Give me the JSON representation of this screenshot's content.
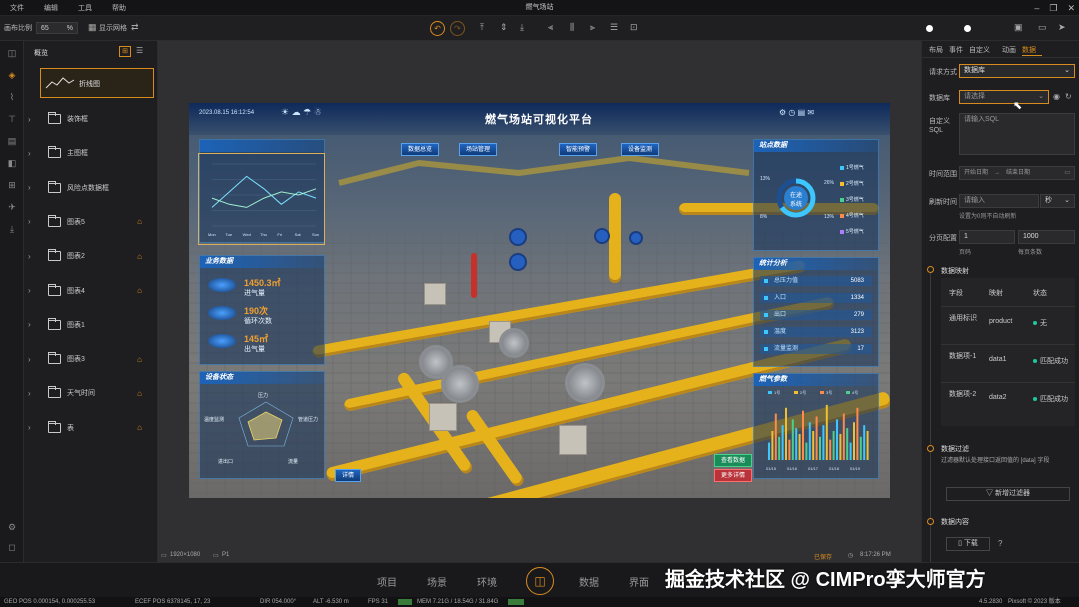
{
  "menubar": {
    "items": [
      "文件",
      "编辑",
      "工具",
      "帮助"
    ],
    "title": "燃气场站"
  },
  "toolbar": {
    "scale_label": "画布比例",
    "scale_value": "65",
    "scale_unit": "%",
    "grid_label": "显示网格",
    "right_btns": [
      "预览",
      "发布"
    ]
  },
  "layers": {
    "title": "概览",
    "top_item": "折线图",
    "items": [
      {
        "name": "装饰框",
        "locked": false
      },
      {
        "name": "主图框",
        "locked": false
      },
      {
        "name": "风险点数据框",
        "locked": false
      },
      {
        "name": "图表5",
        "locked": true
      },
      {
        "name": "图表2",
        "locked": true
      },
      {
        "name": "图表4",
        "locked": true
      },
      {
        "name": "图表1",
        "locked": false
      },
      {
        "name": "图表3",
        "locked": true
      },
      {
        "name": "天气时间",
        "locked": true
      },
      {
        "name": "表",
        "locked": true
      }
    ]
  },
  "scene": {
    "datetime": "2023.08.15 16:12:54",
    "title": "燃气场站可视化平台",
    "nav": [
      "数据总览",
      "场站管理",
      "智能预警",
      "设备监测"
    ],
    "panels": {
      "site": "站点数据",
      "business": "业务数据",
      "stats": "统计分析",
      "device": "设备状态",
      "gas": "燃气参数"
    },
    "ring_label": "在途\n系统",
    "pct_left": [
      "13%",
      "8%"
    ],
    "pct_right": [
      "26%",
      "13%"
    ],
    "legend": [
      "1号燃气",
      "2号燃气",
      "3号燃气",
      "4号燃气",
      "5号燃气"
    ],
    "business": [
      {
        "value": "1450.3㎡",
        "label": "进气量"
      },
      {
        "value": "190次",
        "label": "循环次数"
      },
      {
        "value": "145㎡",
        "label": "出气量"
      }
    ],
    "stats": [
      {
        "label": "总压力值",
        "value": "5083"
      },
      {
        "label": "入口",
        "value": "1334"
      },
      {
        "label": "出口",
        "value": "279"
      },
      {
        "label": "温度",
        "value": "3123"
      },
      {
        "label": "流量监测",
        "value": "17"
      }
    ],
    "device_labels": [
      "压力",
      "温度监测",
      "管道压力",
      "进出口",
      "流量"
    ],
    "device_btn": "详情",
    "gas_legend": [
      "1号",
      "2号",
      "3号",
      "4号"
    ],
    "gas_xlabels": [
      "01/15",
      "01/16",
      "01/17",
      "01/18",
      "01/19"
    ],
    "gas_btns": [
      "查看数据",
      "更多详情"
    ],
    "linechart_x": [
      "Mon",
      "Tue",
      "Wed",
      "Thu",
      "Fri",
      "Sat",
      "Sun"
    ]
  },
  "canvasfoot": {
    "size": "1920×1080",
    "page": "P1",
    "status": "已保存",
    "time": "8:17:26 PM"
  },
  "right": {
    "tabs": [
      "布局",
      "事件",
      "自定义",
      "动画",
      "数据"
    ],
    "request_label": "请求方式",
    "request_value": "数据库",
    "db_label": "数据库",
    "db_value": "请选择",
    "sql_label": "自定义SQL",
    "sql_placeholder": "请输入SQL",
    "time_label": "时间范围",
    "time_start": "开始日期",
    "time_end": "结束日期",
    "refresh_label": "刷新时间",
    "refresh_placeholder": "请输入",
    "refresh_unit": "秒",
    "refresh_hint": "设置为0则不自动刷新",
    "page_label": "分页配置",
    "page_num": "1",
    "page_size": "1000",
    "page_num_lbl": "页码",
    "page_size_lbl": "每页条数",
    "mapping_title": "数据映射",
    "table_head": [
      "字段",
      "映射",
      "状态"
    ],
    "table_rows": [
      {
        "f": "通用标识",
        "m": "product",
        "s": "无"
      },
      {
        "f": "数据项-1",
        "m": "data1",
        "s": "匹配成功"
      },
      {
        "f": "数据项-2",
        "m": "data2",
        "s": "匹配成功"
      }
    ],
    "filter_title": "数据过滤",
    "filter_hint": "过滤器默认处理接口返回值的 [data] 字段",
    "filter_btn": "新增过滤器",
    "content_title": "数据内容",
    "download": "下载"
  },
  "bottom": {
    "nav": [
      "项目",
      "场景",
      "环境",
      "数据",
      "界面"
    ]
  },
  "watermark": "掘金技术社区 @ CIMPro孪大师官方",
  "status": {
    "geo": "GEO POS  0.000154, 0.000255.53",
    "ecef": "ECEF POS  6378145, 17, 23",
    "dir": "DIR  054.000°",
    "alt": "ALT  -6.530 m",
    "fps": "FPS  31",
    "mem": "MEM  7.21G / 18.54G / 31.84G",
    "version": "4.5.2830",
    "copy": "Pixsoft © 2023  版本"
  },
  "colors": {
    "accent": "#d98c1e",
    "pipe": "#e6b21c",
    "cyan": "#3ec7ff"
  }
}
